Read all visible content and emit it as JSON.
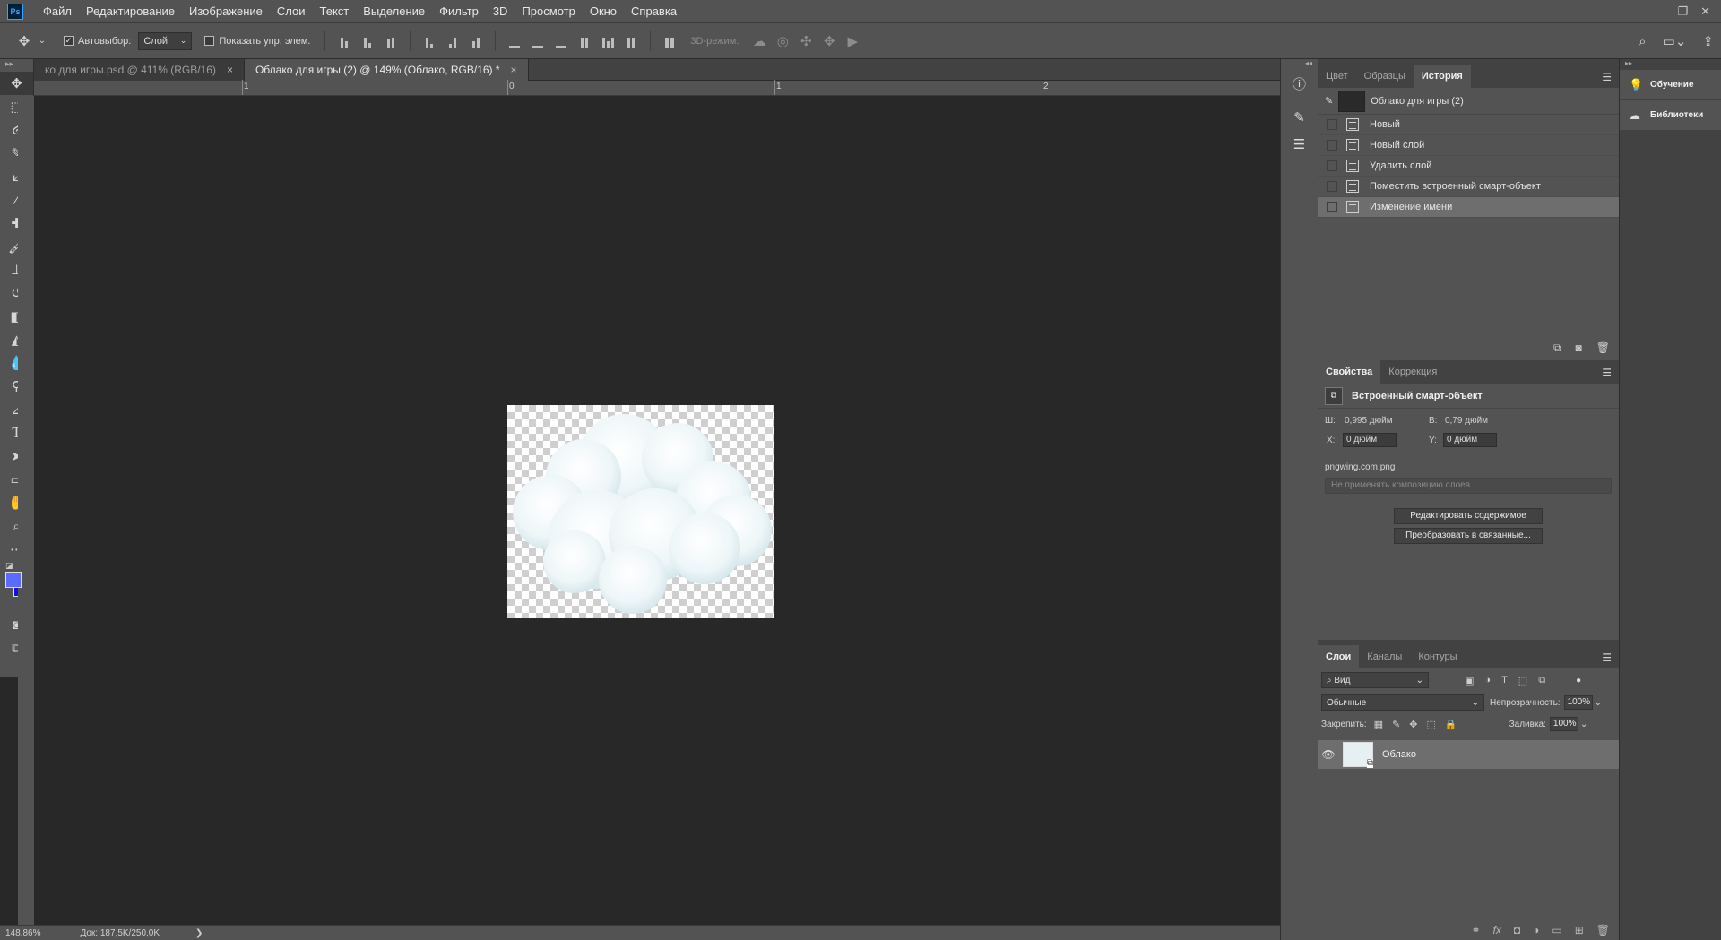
{
  "menu": [
    "Файл",
    "Редактирование",
    "Изображение",
    "Слои",
    "Текст",
    "Выделение",
    "Фильтр",
    "3D",
    "Просмотр",
    "Окно",
    "Справка"
  ],
  "window_controls": [
    "—",
    "❐",
    "✕"
  ],
  "options": {
    "autoselect_label": "Автовыбор:",
    "autoselect_value": "Слой",
    "show_controls_label": "Показать упр. элем.",
    "mode_3d_label": "3D-режим:"
  },
  "tabs": [
    {
      "label": "ко для игры.psd @ 411% (RGB/16)",
      "close": "×"
    },
    {
      "label": "Облако для игры (2) @ 149% (Облако, RGB/16) *",
      "close": "×"
    }
  ],
  "ruler": {
    "h_labels": [
      "1",
      "0",
      "1",
      "2"
    ]
  },
  "status": {
    "zoom": "148,86%",
    "doc": "Док: 187,5K/250,0K",
    "arrow": "❯"
  },
  "history": {
    "tabs": [
      "Цвет",
      "Образцы",
      "История"
    ],
    "snapshot": "Облако для игры (2)",
    "items": [
      "Новый",
      "Новый слой",
      "Удалить слой",
      "Поместить встроенный смарт-объект",
      "Изменение имени"
    ],
    "selected_index": 4
  },
  "properties": {
    "tabs": [
      "Свойства",
      "Коррекция"
    ],
    "header": "Встроенный смарт-объект",
    "w_label": "Ш:",
    "w_value": "0,995 дюйм",
    "h_label": "В:",
    "h_value": "0,79 дюйм",
    "x_label": "X:",
    "x_value": "0 дюйм",
    "y_label": "Y:",
    "y_value": "0 дюйм",
    "file": "pngwing.com.png",
    "comp_placeholder": "Не применять композицию слоев",
    "edit_button": "Редактировать содержимое",
    "convert_button": "Преобразовать в связанные..."
  },
  "layers": {
    "tabs": [
      "Слои",
      "Каналы",
      "Контуры"
    ],
    "filter": "Вид",
    "blend": "Обычные",
    "opacity_label": "Непрозрачность:",
    "opacity": "100%",
    "lock_label": "Закрепить:",
    "fill_label": "Заливка:",
    "fill": "100%",
    "items": [
      {
        "name": "Облако"
      }
    ]
  },
  "side": {
    "learn": "Обучение",
    "libraries": "Библиотеки"
  },
  "colors": {
    "foreground": "#5a6bff",
    "background": "#1010e0"
  }
}
